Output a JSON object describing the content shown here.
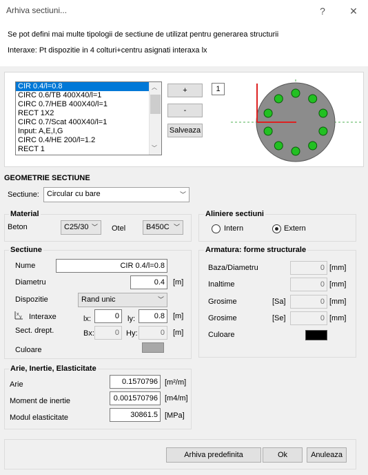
{
  "window": {
    "title": "Arhiva sectiuni...",
    "help_glyph": "?",
    "close_glyph": "✕"
  },
  "info": {
    "line1": "Se pot defini mai multe tipologii de sectiune de utilizat pentru generarea structurii",
    "line2": "Interaxe:   Pt dispozitie in 4 colturi+centru asignati interaxa lx"
  },
  "list": {
    "items": [
      "CIR 0.4/l=0.8",
      "CIRC 0.6/TB 400X40/l=1",
      "CIRC 0.7/HEB 400X40/l=1",
      "RECT 1X2",
      "CIRC 0.7/Scat 400X40/l=1",
      "Input: A,E,I,G",
      "CIRC 0.4/HE 200/l=1.2",
      "RECT 1"
    ],
    "selected_index": 0
  },
  "buttons": {
    "add": "+",
    "remove": "-",
    "save": "Salveaza",
    "counter": "1"
  },
  "geometry": {
    "title": "GEOMETRIE SECTIUNE",
    "section_label": "Sectiune:",
    "section_value": "Circular cu bare"
  },
  "material": {
    "title": "Material",
    "beton_label": "Beton",
    "beton_value": "C25/30",
    "otel_label": "Otel",
    "otel_value": "B450C"
  },
  "aliniere": {
    "title": "Aliniere sectiuni",
    "intern": "Intern",
    "extern": "Extern",
    "selected": "Extern"
  },
  "sectiune": {
    "title": "Sectiune",
    "nume_label": "Nume",
    "nume_value": "CIR 0.4/l=0.8",
    "diametru_label": "Diametru",
    "diametru_value": "0.4",
    "diametru_unit": "[m]",
    "dispozitie_label": "Dispozitie",
    "dispozitie_value": "Rand unic",
    "interaxe_label": "Interaxe",
    "lx_label": "lx:",
    "lx_value": "0",
    "ly_label": "ly:",
    "ly_value": "0.8",
    "interaxe_unit": "[m]",
    "sect_drept_label": "Sect. drept.",
    "bx_label": "Bx:",
    "bx_value": "0",
    "hy_label": "Hy:",
    "hy_value": "0",
    "sect_unit": "[m]",
    "culoare_label": "Culoare",
    "culoare_color": "#a8a8a8"
  },
  "armatura": {
    "title": "Armatura: forme structurale",
    "baza_label": "Baza/Diametru",
    "baza_value": "0",
    "baza_unit": "[mm]",
    "inaltime_label": "Inaltime",
    "inaltime_value": "0",
    "inaltime_unit": "[mm]",
    "grosime_sa_label": "Grosime",
    "grosime_sa_tag": "[Sa]",
    "grosime_sa_value": "0",
    "grosime_sa_unit": "[mm]",
    "grosime_se_label": "Grosime",
    "grosime_se_tag": "[Se]",
    "grosime_se_value": "0",
    "grosime_se_unit": "[mm]",
    "culoare_label": "Culoare",
    "culoare_color": "#000000"
  },
  "arie": {
    "title": "Arie, Inertie, Elasticitate",
    "arie_label": "Arie",
    "arie_value": "0.1570796",
    "arie_unit": "[m²/m]",
    "moment_label": "Moment de inertie",
    "moment_value": "0.001570796",
    "moment_unit": "[m4/m]",
    "modul_label": "Modul elasticitate",
    "modul_value": "30861.5",
    "modul_unit": "[MPa]"
  },
  "footer": {
    "predef": "Arhiva predefinita",
    "ok": "Ok",
    "cancel": "Anuleaza"
  },
  "preview": {
    "circle_fill": "#8c8c8c",
    "bar_fill": "#22c022",
    "axis_color": "#dd2020",
    "guide_color": "#4caf50"
  }
}
